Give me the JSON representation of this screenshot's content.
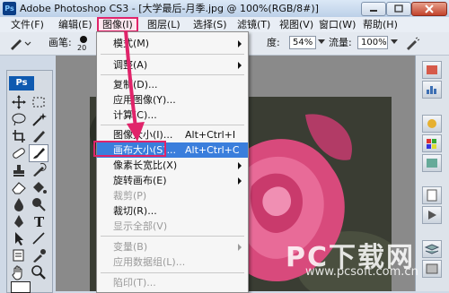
{
  "window": {
    "app_icon": "Ps",
    "title": "Adobe Photoshop CS3 - [大学最后-月季.jpg @ 100%(RGB/8#)]"
  },
  "menubar": {
    "items": [
      "文件(F)",
      "编辑(E)",
      "图像(I)",
      "图层(L)",
      "选择(S)",
      "滤镜(T)",
      "视图(V)",
      "窗口(W)",
      "帮助(H)"
    ],
    "active": "图像(I)",
    "highlight_color": "#e0246a"
  },
  "options": {
    "brush_label": "画笔:",
    "brush_size": "20",
    "opacity_label": "度:",
    "opacity_value": "54%",
    "flow_label": "流量:",
    "flow_value": "100%"
  },
  "toolbox": {
    "logo": "Ps",
    "tools": [
      "move-icon",
      "marquee-icon",
      "lasso-icon",
      "magic-wand-icon",
      "crop-icon",
      "slice-icon",
      "healing-icon",
      "brush-icon",
      "stamp-icon",
      "history-brush-icon",
      "eraser-icon",
      "fill-icon",
      "blur-icon",
      "dodge-icon",
      "pen-icon",
      "type-icon",
      "path-select-icon",
      "shape-icon",
      "notes-icon",
      "eyedropper-icon",
      "hand-icon",
      "zoom-icon"
    ]
  },
  "image_menu": {
    "items": [
      {
        "label": "模式(M)",
        "submenu": true,
        "enabled": true
      },
      {
        "sep": true
      },
      {
        "label": "调整(A)",
        "submenu": true,
        "enabled": true
      },
      {
        "sep": true
      },
      {
        "label": "复制(D)...",
        "enabled": true
      },
      {
        "label": "应用图像(Y)...",
        "enabled": true
      },
      {
        "label": "计算(C)...",
        "enabled": true
      },
      {
        "sep": true
      },
      {
        "label": "图像大小(I)...",
        "shortcut": "Alt+Ctrl+I",
        "enabled": true
      },
      {
        "label": "画布大小(S)...",
        "shortcut": "Alt+Ctrl+C",
        "enabled": true,
        "highlighted": true
      },
      {
        "label": "像素长宽比(X)",
        "submenu": true,
        "enabled": true
      },
      {
        "label": "旋转画布(E)",
        "submenu": true,
        "enabled": true
      },
      {
        "label": "裁剪(P)",
        "enabled": false
      },
      {
        "label": "裁切(R)...",
        "enabled": true
      },
      {
        "label": "显示全部(V)",
        "enabled": false
      },
      {
        "sep": true
      },
      {
        "label": "变量(B)",
        "submenu": true,
        "enabled": false
      },
      {
        "label": "应用数据组(L)...",
        "enabled": false
      },
      {
        "sep": true
      },
      {
        "label": "陷印(T)...",
        "enabled": false
      }
    ],
    "highlight_bg": "#3a7edc"
  },
  "watermark": {
    "text": "PC下载网",
    "url": "www.pcsoft.com.cn"
  }
}
